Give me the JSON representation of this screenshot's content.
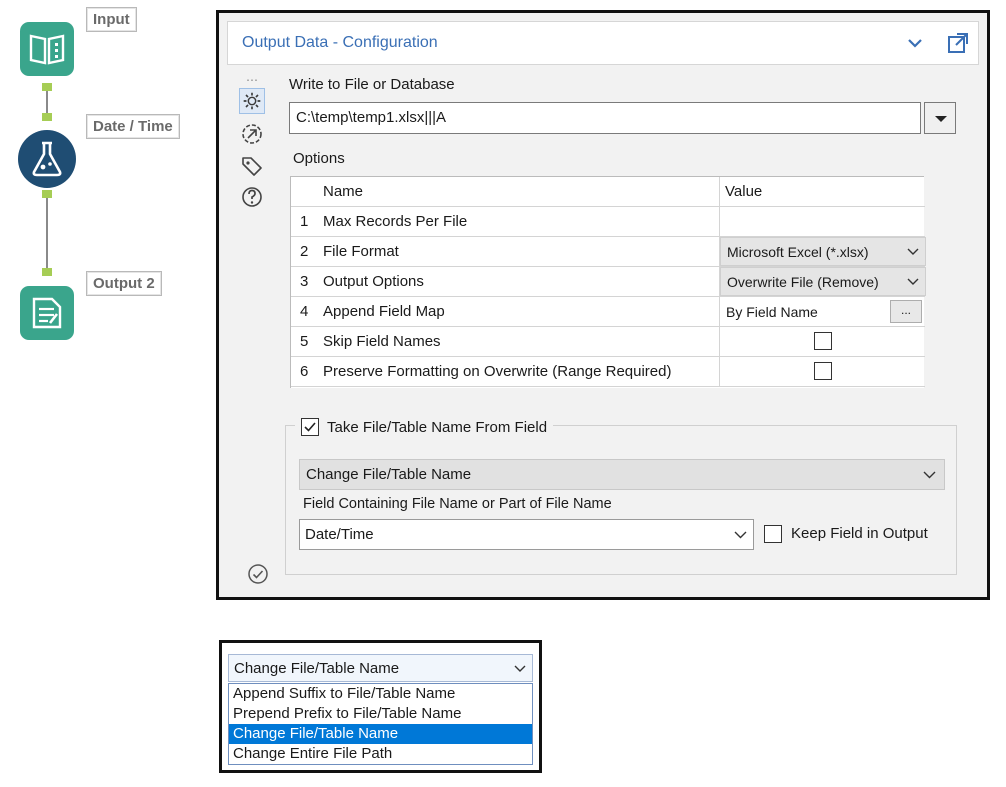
{
  "workflow": {
    "tools": [
      {
        "label": "Input",
        "icon": "book-icon",
        "color": "#3aa58c"
      },
      {
        "label": "Date / Time",
        "icon": "flask-icon",
        "color": "#1f4d73"
      },
      {
        "label": "Output 2",
        "icon": "document-icon",
        "color": "#3aa58c"
      }
    ]
  },
  "config": {
    "title": "Output Data - Configuration",
    "write_label": "Write to File or Database",
    "path_value": "C:\\temp\\temp1.xlsx|||A",
    "options_label": "Options",
    "grid": {
      "col_name": "Name",
      "col_value": "Value",
      "rows": [
        {
          "num": "1",
          "name": "Max Records Per File",
          "value": ""
        },
        {
          "num": "2",
          "name": "File Format",
          "value": "Microsoft Excel (*.xlsx)"
        },
        {
          "num": "3",
          "name": "Output Options",
          "value": "Overwrite File (Remove)"
        },
        {
          "num": "4",
          "name": "Append Field Map",
          "value": "By Field Name",
          "button": "..."
        },
        {
          "num": "5",
          "name": "Skip Field Names",
          "value": ""
        },
        {
          "num": "6",
          "name": "Preserve Formatting on Overwrite (Range Required)",
          "value": ""
        }
      ]
    },
    "take_name_label": "Take File/Table Name From Field",
    "change_mode_value": "Change File/Table Name",
    "field_label": "Field Containing File Name or Part of File Name",
    "field_value": "Date/Time",
    "keep_field_label": "Keep Field in Output"
  },
  "dropdown": {
    "selected": "Change File/Table Name",
    "options": [
      "Append Suffix to File/Table Name",
      "Prepend Prefix to File/Table Name",
      "Change File/Table Name",
      "Change Entire File Path"
    ],
    "highlighted_index": 2
  },
  "colors": {
    "title_blue": "#3a6fb5",
    "tool_green": "#3aa58c",
    "tool_navy": "#1f4d73",
    "selection": "#0078d7"
  }
}
